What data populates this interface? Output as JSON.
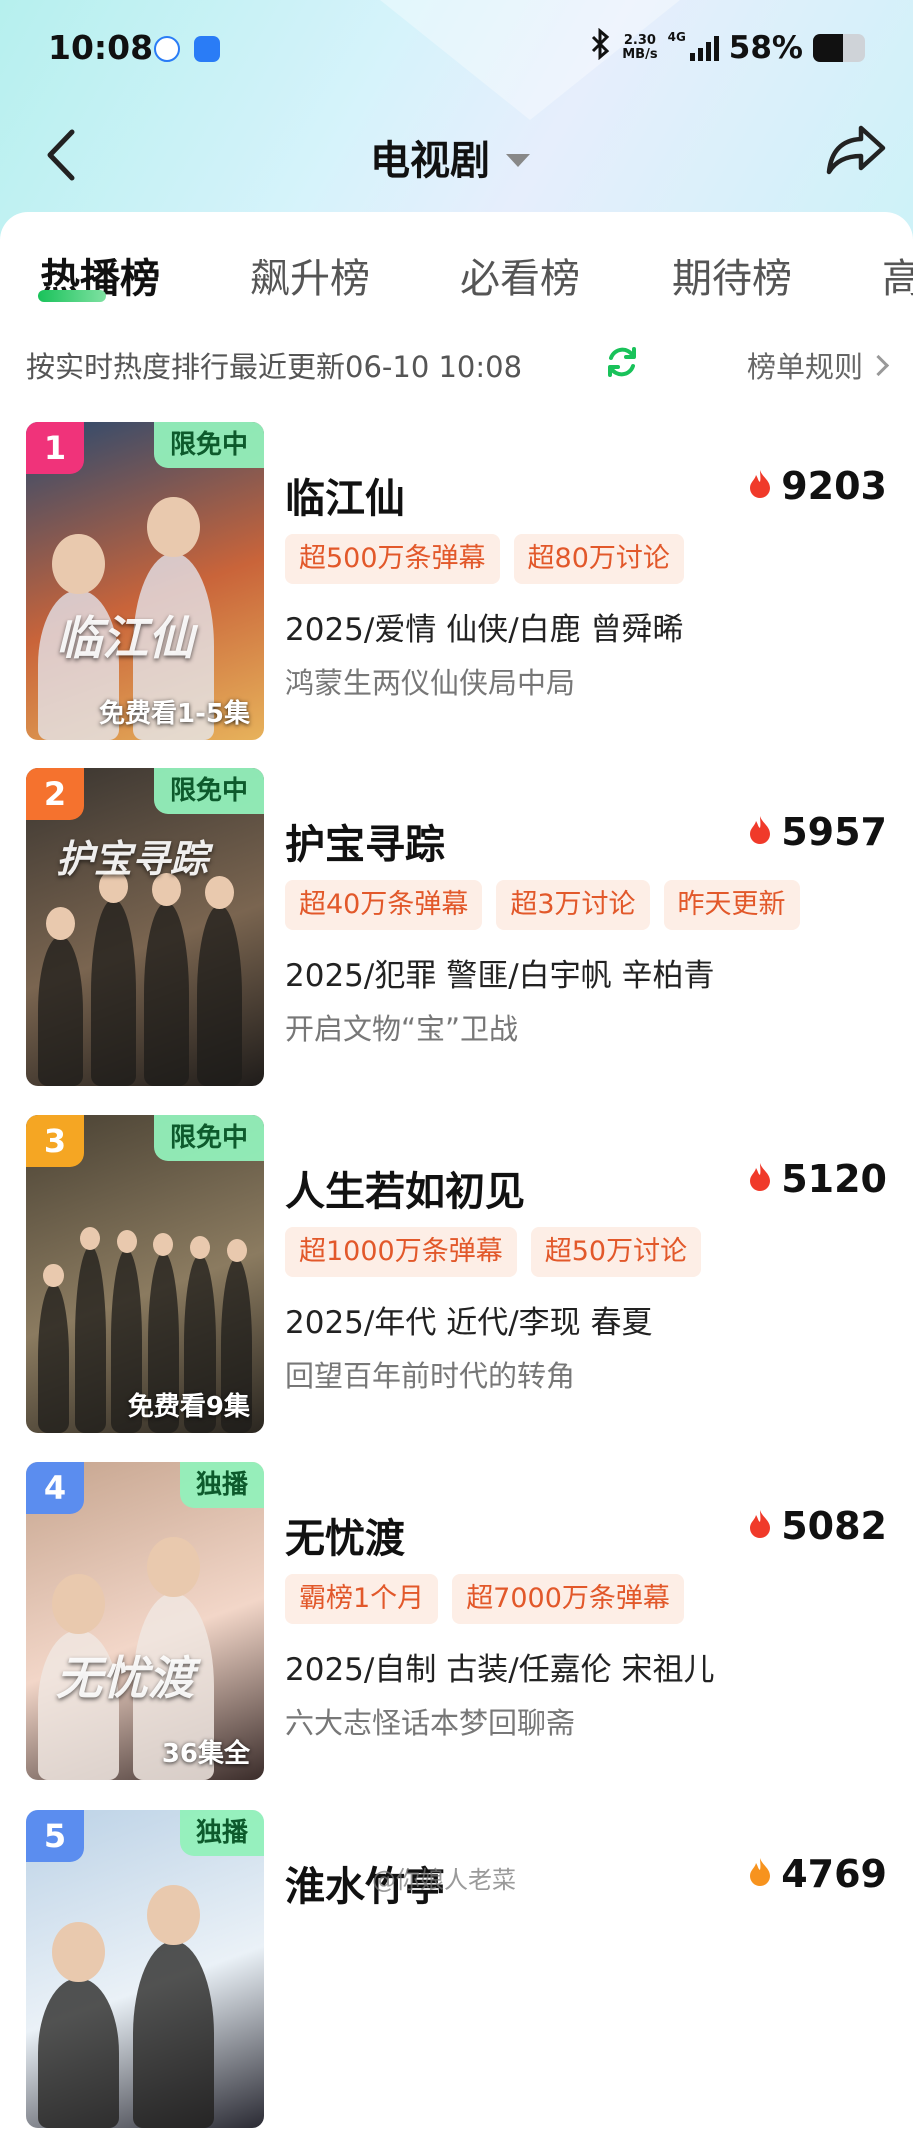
{
  "status_bar": {
    "time": "10:08",
    "net_speed_value": "2.30",
    "net_speed_unit": "MB/s",
    "network": "4G",
    "battery": "58%",
    "battery_level": 0.58
  },
  "header": {
    "title": "电视剧"
  },
  "tabs": [
    "热播榜",
    "飙升榜",
    "必看榜",
    "期待榜",
    "高"
  ],
  "info": {
    "update_text": "按实时热度排行最近更新06-10 10:08",
    "rules_link": "榜单规则"
  },
  "list": [
    {
      "rank": "1",
      "rank_color": "#f0337a",
      "tag": "限免中",
      "caption": "免费看1-5集",
      "art_title": "临江仙",
      "title": "临江仙",
      "heat": "9203",
      "badges": [
        "超500万条弹幕",
        "超80万讨论"
      ],
      "meta": "2025/爱情 仙侠/白鹿 曾舜晞",
      "desc": "鸿蒙生两仪仙侠局中局",
      "poster_colors": [
        "#2b4a6f",
        "#c9643a",
        "#e7b25b"
      ]
    },
    {
      "rank": "2",
      "rank_color": "#f5722e",
      "tag": "限免中",
      "caption": "",
      "art_title": "护宝寻踪",
      "title": "护宝寻踪",
      "heat": "5957",
      "badges": [
        "超40万条弹幕",
        "超3万讨论",
        "昨天更新"
      ],
      "meta": "2025/犯罪 警匪/白宇帆 辛柏青",
      "desc": "开启文物“宝”卫战",
      "poster_colors": [
        "#3a3530",
        "#7a6550",
        "#1f1c1a"
      ]
    },
    {
      "rank": "3",
      "rank_color": "#f5a623",
      "tag": "限免中",
      "caption": "免费看9集",
      "art_title": "",
      "title": "人生若如初见",
      "heat": "5120",
      "badges": [
        "超1000万条弹幕",
        "超50万讨论"
      ],
      "meta": "2025/年代 近代/李现 春夏",
      "desc": "回望百年前时代的转角",
      "poster_colors": [
        "#4a4234",
        "#8b7b60",
        "#2a2620"
      ]
    },
    {
      "rank": "4",
      "rank_color": "#5b8def",
      "tag": "独播",
      "caption": "36集全",
      "art_title": "无忧渡",
      "title": "无忧渡",
      "heat": "5082",
      "badges": [
        "霸榜1个月",
        "超7000万条弹幕"
      ],
      "meta": "2025/自制 古装/任嘉伦 宋祖儿",
      "desc": "六大志怪话本梦回聊斋",
      "poster_colors": [
        "#c6a58f",
        "#f2d6c8",
        "#3a2c2a"
      ]
    },
    {
      "rank": "5",
      "rank_color": "#5b8def",
      "tag": "独播",
      "caption": "",
      "art_title": "",
      "title": "淮水竹亭",
      "heat": "4769",
      "badges": [],
      "meta": "",
      "desc": "",
      "poster_colors": [
        "#bcd2e6",
        "#eaf1f7",
        "#2a2a33"
      ]
    }
  ],
  "watermark": "@你娘人老菜",
  "colors": {
    "accent_green": "#19c25a",
    "badge_bg": "#fdeee6",
    "badge_text": "#e2582a",
    "flame": "#f03a2a"
  }
}
